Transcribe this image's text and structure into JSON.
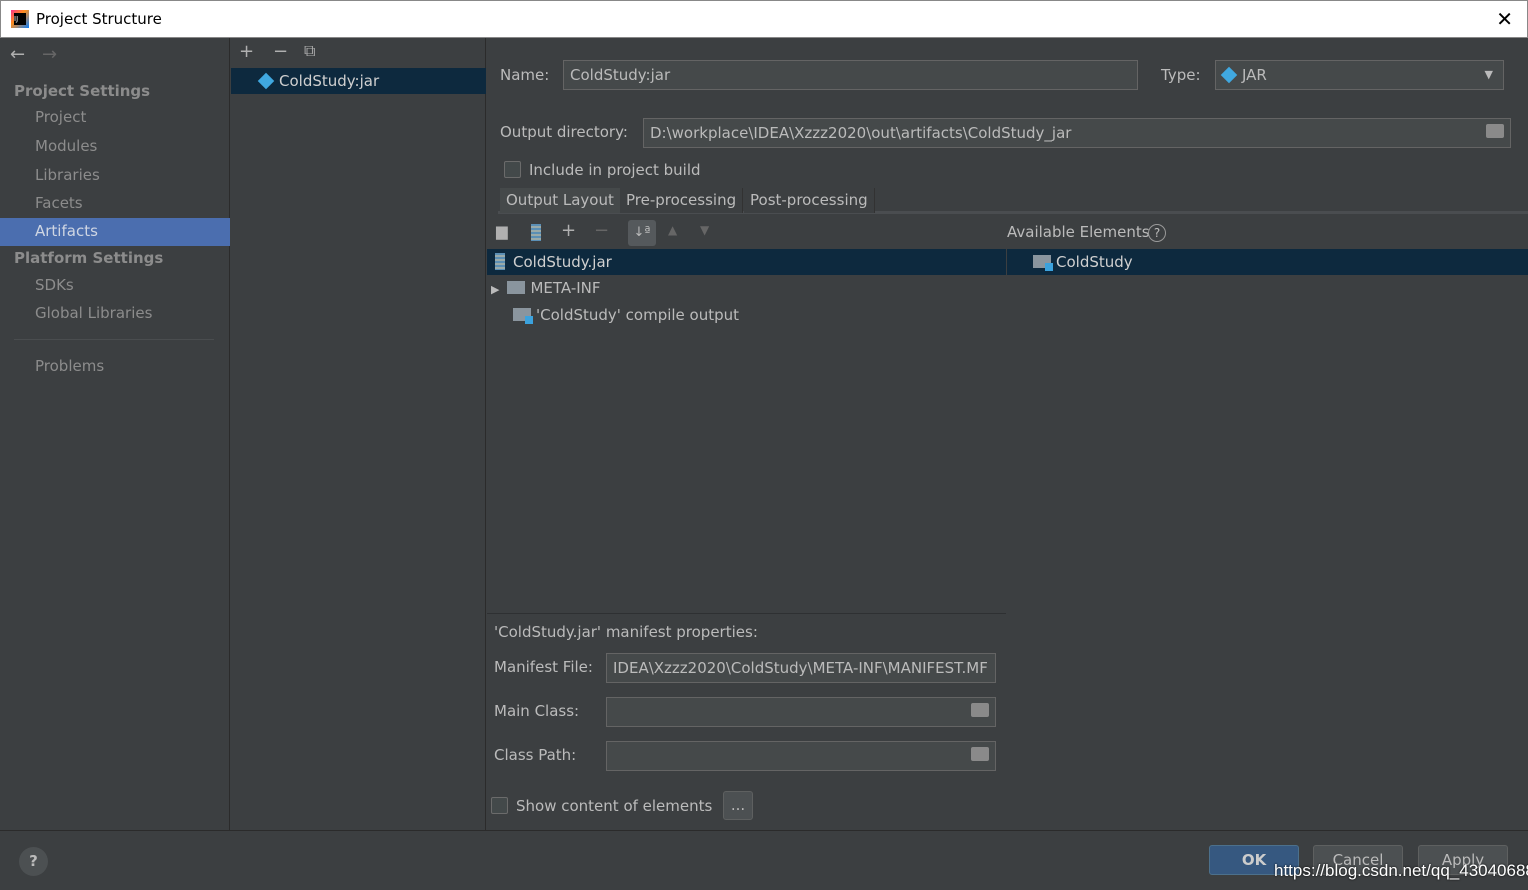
{
  "window": {
    "title": "Project Structure"
  },
  "sidebar": {
    "sections": [
      {
        "title": "Project Settings",
        "items": [
          "Project",
          "Modules",
          "Libraries",
          "Facets",
          "Artifacts"
        ]
      },
      {
        "title": "Platform Settings",
        "items": [
          "SDKs",
          "Global Libraries"
        ]
      }
    ],
    "problems": "Problems",
    "selected": "Artifacts"
  },
  "artifacts": {
    "items": [
      "ColdStudy:jar"
    ]
  },
  "form": {
    "name_label": "Name:",
    "name_value": "ColdStudy:jar",
    "type_label": "Type:",
    "type_value": "JAR",
    "output_label": "Output directory:",
    "output_value": "D:\\workplace\\IDEA\\Xzzz2020\\out\\artifacts\\ColdStudy_jar",
    "include_label": "Include in project build",
    "include_checked": false
  },
  "tabs": [
    "Output Layout",
    "Pre-processing",
    "Post-processing"
  ],
  "layout": {
    "tree": [
      "ColdStudy.jar",
      "META-INF",
      "'ColdStudy' compile output"
    ],
    "available_title": "Available Elements",
    "available": [
      "ColdStudy"
    ]
  },
  "manifest": {
    "title": "'ColdStudy.jar' manifest properties:",
    "file_label": "Manifest File:",
    "file_value": "IDEA\\Xzzz2020\\ColdStudy\\META-INF\\MANIFEST.MF",
    "main_label": "Main Class:",
    "main_value": "",
    "path_label": "Class Path:",
    "path_value": "",
    "show_label": "Show content of elements",
    "more": "..."
  },
  "buttons": {
    "ok": "OK",
    "cancel": "Cancel",
    "apply": "Apply",
    "help": "?"
  },
  "watermark": "https://blog.csdn.net/qq_43040688",
  "colors": {
    "selection": "#4b6eaf",
    "tree_selection": "#0d293e",
    "accent_icon": "#40a8e0"
  }
}
